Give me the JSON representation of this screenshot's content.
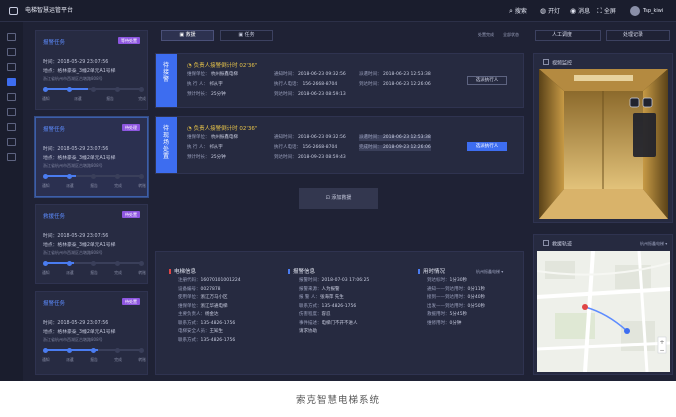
{
  "app": {
    "title": "电梯智慧运管平台"
  },
  "topbar": {
    "items": [
      {
        "icon": "search-icon",
        "label": "搜索"
      },
      {
        "icon": "lock-icon",
        "label": "开灯"
      },
      {
        "icon": "bell-icon",
        "label": "消息"
      },
      {
        "icon": "fullscreen-icon",
        "label": "全屏"
      }
    ],
    "user": "Tsp_kiwi"
  },
  "tasks": [
    {
      "title": "报警任务",
      "badge": "等待处置",
      "time": "时间：2018-05-29 23:07:56",
      "place": "地点：格林豪泰_3幢2单元A1号梯",
      "addr": "浙江省杭州市西湖区古墩路808号",
      "steps": [
        "通知",
        "派遣",
        "报告",
        "完成"
      ],
      "progress": 0.45
    },
    {
      "title": "报警任务",
      "badge": "待处理",
      "time": "时间：2018-05-29 23:07:56",
      "place": "地点：格林豪泰_3幢2单元A1号梯",
      "addr": "浙江省杭州市西湖区古墩路808号",
      "steps": [
        "通知",
        "派遣",
        "报告",
        "完成",
        "转账"
      ],
      "progress": 0.32
    },
    {
      "title": "救援任务",
      "badge": "待处置",
      "time": "时间：2018-05-29 23:07:56",
      "place": "地点：格林豪泰_3幢2单元A1号梯",
      "addr": "浙江省杭州市西湖区古墩路808号",
      "steps": [
        "通知",
        "派遣",
        "报告",
        "完成",
        "转账"
      ],
      "progress": 0.3
    },
    {
      "title": "报警任务",
      "badge": "待处置",
      "time": "时间：2018-05-29 23:07:56",
      "place": "地点：格林豪泰_3幢2单元A1号梯",
      "addr": "浙江省杭州市西湖区古墩路808号",
      "steps": [
        "通知",
        "派遣",
        "报告",
        "完成",
        "转账"
      ],
      "progress": 0.55
    }
  ],
  "tabs": [
    "救援",
    "任务"
  ],
  "filters": {
    "status": "处置完成",
    "all": "全部状态"
  },
  "buttons": {
    "manual": "人工调度",
    "log": "处理记录"
  },
  "cards": [
    {
      "side": "待接警",
      "head": "负责人接警倒计时",
      "timer": "02'36\"",
      "rows": [
        [
          "维保单位：",
          "杭州振鑫电梯",
          "通知时间：",
          "2018-06-23 09:32:56",
          "派遣时间：",
          "2018-06-23 12:53:38"
        ],
        [
          "执 行 人：",
          "祁从宇",
          "执行人电话：",
          "156-2668-8704",
          "到达时间：",
          "2018-06-23 12:26:06"
        ],
        [
          "预计时长：",
          "25分钟",
          "到达时间：",
          "2018-06-23 08:59:13",
          "",
          ""
        ]
      ],
      "action": "选派执行人",
      "primary": false
    },
    {
      "side": "待现场处置",
      "head": "负责人接警倒计时",
      "timer": "02'36\"",
      "rows": [
        [
          "维保单位：",
          "杭州振鑫电梯",
          "通知时间：",
          "2018-06-23 09:32:56",
          "派遣时间：",
          "2018-06-23 12:53:38"
        ],
        [
          "执 行 人：",
          "祁从宇",
          "执行人电话：",
          "156-2668-8704",
          "完成时间：",
          "2018-09-23 12:26:06"
        ],
        [
          "预计时长：",
          "25分钟",
          "到达时间：",
          "2018-09-23 08:59:43",
          "",
          ""
        ]
      ],
      "action": "选派执行人",
      "primary": true
    }
  ],
  "add_button": "添加救援",
  "elevator_info": {
    "title": "电梯信息",
    "rows": [
      [
        "注册代码：",
        "16070101001224"
      ],
      [
        "设备编号：",
        "0027878"
      ],
      [
        "使用单位：",
        "浙江万马小区"
      ],
      [
        "维保单位：",
        "浙江华通电梯"
      ],
      [
        "主要负责人：",
        "杨金达"
      ],
      [
        "联系方式：",
        "135-4826-1756"
      ],
      [
        "电梯安全人员：",
        "王知生"
      ],
      [
        "联系方式：",
        "135-4826-1756"
      ]
    ]
  },
  "alarm_info": {
    "title": "报警信息",
    "rows": [
      [
        "报警时间：",
        "2018-07-03 17:06:25"
      ],
      [
        "报警来源：",
        "人为报警"
      ],
      [
        "报 警 人：",
        "张海萍 先生"
      ],
      [
        "联系方式：",
        "135-4826-1756"
      ],
      [
        "伤害程度：",
        "容忍"
      ],
      [
        "事件描述：",
        "电梯门不开不进人"
      ],
      [
        "",
        "请求协助"
      ]
    ]
  },
  "time_info": {
    "title": "用时情况",
    "filter": "杭州振鑫电梯",
    "rows": [
      [
        "到达标时：",
        "1分30秒"
      ],
      [
        "通知——到达用时：",
        "0分11秒"
      ],
      [
        "接到——到达用时：",
        "0分40秒"
      ],
      [
        "出发——到达用时：",
        "0分50秒"
      ],
      [
        "救援用时：",
        "5分45秒"
      ],
      [
        "维修用时：",
        "0分钟"
      ]
    ]
  },
  "video_panel": {
    "title": "视频监控"
  },
  "map_panel": {
    "title": "救援轨迹",
    "filter": "杭州振鑫电梯"
  },
  "caption": "索克智慧电梯系统"
}
